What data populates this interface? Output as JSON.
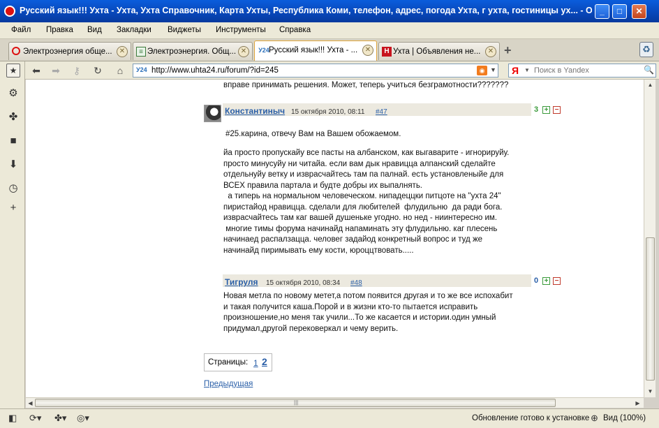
{
  "window": {
    "title": "Русский язык!!! Ухта - Ухта, Ухта Справочник, Карта Ухты, Республика Коми, телефон, адрес, погода Ухта, г ухта, гостиницы ух... - O..."
  },
  "menu": [
    "Файл",
    "Правка",
    "Вид",
    "Закладки",
    "Виджеты",
    "Инструменты",
    "Справка"
  ],
  "tabs": [
    {
      "title": "Электроэнергия обще...",
      "favicon": "opera-o-icon",
      "active": false
    },
    {
      "title": "Электроэнергия. Общ...",
      "favicon": "page-icon",
      "active": false
    },
    {
      "title": "Русский язык!!! Ухта - ...",
      "favicon": "y24",
      "active": true
    },
    {
      "title": "Ухта | Объявления не...",
      "favicon": "H",
      "active": false
    }
  ],
  "address": {
    "site_badge": "У24",
    "url": "http://www.uhta24.ru/forum/?id=245"
  },
  "search": {
    "engine_letter": "Я",
    "placeholder": "Поиск в Yandex"
  },
  "content": {
    "top_line": "вправе принимать решения. Может, теперь учиться безграмотности???????",
    "posts": [
      {
        "author": "Константиныч",
        "date": "15 октября 2010, 08:11",
        "number": "#47",
        "rating": "3",
        "rating_color": "#3a9a3a",
        "lines": [
          "#25.карина, отвечу Вам на Вашем обожаемом.",
          "",
          "йа просто пропускайу все пасты на албанском, как выгаварите - игнорируйу.",
          "просто минусуйу ни читайа. если вам дык нравицца алпанский сделайте",
          "отдельнуйу ветку и изврасчайтесь там па палнай. есть установленыйе для",
          "ВСЕХ правила партала и будте добры их выпалнять.",
          "  а типерь на нормальном человеческом. нипадеццки питцоте на \"ухта 24\"",
          "пиристайод нравицца. сделали для любителей  флудильню  да ради бога.",
          "изврасчайтесь там каг вашей душенькe угодно. но нед - ниинтересно им.",
          " многие тимы форума начинайд напаминать эту флудильню. каг плесень",
          "начинаед распалзацца. человег задайод конкретный вопрос и туд же",
          "начинайд пиримывать ему кости, юроццтвовать....."
        ]
      },
      {
        "author": "Тигруля",
        "date": "15 октября 2010, 08:34",
        "number": "#48",
        "rating": "0",
        "rating_color": "#2a5fa8",
        "lines": [
          "Новая метла по новому метет,а потом появится другая и то же все испохабит",
          "и такая получится каша.Порой и в жизни кто-то пытается исправить",
          "произношение,но меня так учили...То же касается и истории.один умный",
          "придумал,другой перековеркал и чему верить."
        ]
      }
    ],
    "pager": {
      "label": "Страницы:",
      "page1": "1",
      "page2": "2"
    },
    "prev_link": "Предыдущая"
  },
  "status": {
    "text": "Обновление готово к установке",
    "zoom": "Вид (100%)"
  }
}
